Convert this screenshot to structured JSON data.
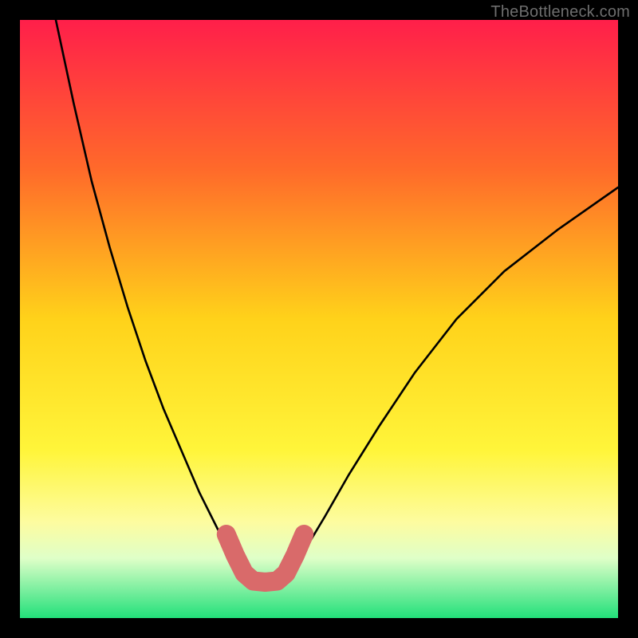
{
  "watermark": "TheBottleneck.com",
  "chart_data": {
    "type": "line",
    "title": "",
    "xlabel": "",
    "ylabel": "",
    "xlim": [
      0,
      100
    ],
    "ylim": [
      0,
      100
    ],
    "gradient_stops": [
      {
        "offset": 0,
        "color": "#ff1f4a"
      },
      {
        "offset": 25,
        "color": "#ff6a2a"
      },
      {
        "offset": 50,
        "color": "#ffd21a"
      },
      {
        "offset": 72,
        "color": "#fff53a"
      },
      {
        "offset": 84,
        "color": "#fdfca0"
      },
      {
        "offset": 90,
        "color": "#dfffc8"
      },
      {
        "offset": 100,
        "color": "#22e07a"
      }
    ],
    "left_curve": {
      "comment": "Black curve, left arm — starts top-left and descends to the trough. y is measured from the TOP of the plot area.",
      "points": [
        {
          "x": 6,
          "y": 0
        },
        {
          "x": 9,
          "y": 14
        },
        {
          "x": 12,
          "y": 27
        },
        {
          "x": 15,
          "y": 38
        },
        {
          "x": 18,
          "y": 48
        },
        {
          "x": 21,
          "y": 57
        },
        {
          "x": 24,
          "y": 65
        },
        {
          "x": 27,
          "y": 72
        },
        {
          "x": 30,
          "y": 79
        },
        {
          "x": 33,
          "y": 85
        },
        {
          "x": 34.5,
          "y": 88
        },
        {
          "x": 36,
          "y": 91
        }
      ]
    },
    "right_curve": {
      "comment": "Black curve, right arm — rises from trough toward upper-right.",
      "points": [
        {
          "x": 46,
          "y": 91
        },
        {
          "x": 48,
          "y": 88
        },
        {
          "x": 51,
          "y": 83
        },
        {
          "x": 55,
          "y": 76
        },
        {
          "x": 60,
          "y": 68
        },
        {
          "x": 66,
          "y": 59
        },
        {
          "x": 73,
          "y": 50
        },
        {
          "x": 81,
          "y": 42
        },
        {
          "x": 90,
          "y": 35
        },
        {
          "x": 100,
          "y": 28
        }
      ]
    },
    "trough_overlay": {
      "comment": "Thick salmon glyph overlay at the trough of the curve, shaped like a shallow U.",
      "color": "#d96a6a",
      "stroke_width_pct": 3.2,
      "points": [
        {
          "x": 34.5,
          "y": 86
        },
        {
          "x": 36.0,
          "y": 89.5
        },
        {
          "x": 37.5,
          "y": 92.5
        },
        {
          "x": 39.0,
          "y": 93.8
        },
        {
          "x": 41.0,
          "y": 94.0
        },
        {
          "x": 43.0,
          "y": 93.8
        },
        {
          "x": 44.5,
          "y": 92.5
        },
        {
          "x": 46.0,
          "y": 89.5
        },
        {
          "x": 47.5,
          "y": 86
        }
      ]
    }
  }
}
